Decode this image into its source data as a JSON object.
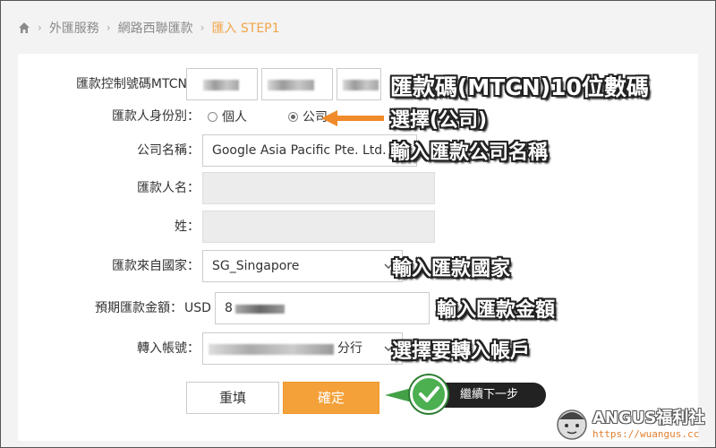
{
  "breadcrumb": {
    "items": [
      "外匯服務",
      "網路西聯匯款",
      "匯入 STEP1"
    ]
  },
  "form": {
    "mtcn_label": "匯款控制號碼MTCN：",
    "identity_label": "匯款人身份別：",
    "identity_options": [
      "個人",
      "公司"
    ],
    "identity_selected": "公司",
    "company_label": "公司名稱：",
    "company_value": "Google Asia Pacific Pte. Ltd.",
    "sender_name_label": "匯款人名：",
    "surname_label": "姓：",
    "country_label": "匯款來自國家：",
    "country_value": "SG_Singapore",
    "amount_label": "預期匯款金額：",
    "currency": "USD",
    "amount_value": "8",
    "account_label": "轉入帳號：",
    "account_suffix": "分行"
  },
  "buttons": {
    "reset": "重填",
    "confirm": "確定"
  },
  "annotations": {
    "mtcn": "匯款碼(MTCN)10位數碼",
    "identity": "選擇(公司)",
    "company": "輸入匯款公司名稱",
    "country": "輸入匯款國家",
    "amount": "輸入匯款金額",
    "account": "選擇要轉入帳戶",
    "next": "繼續下一步"
  },
  "watermark": {
    "title": "ANGUS福利社",
    "url": "https://wuangus.cc"
  },
  "colors": {
    "accent": "#f5a13a",
    "breadcrumb_active": "#f0a64a",
    "arrow": "#f08a2a",
    "next_green": "#4caf50"
  }
}
